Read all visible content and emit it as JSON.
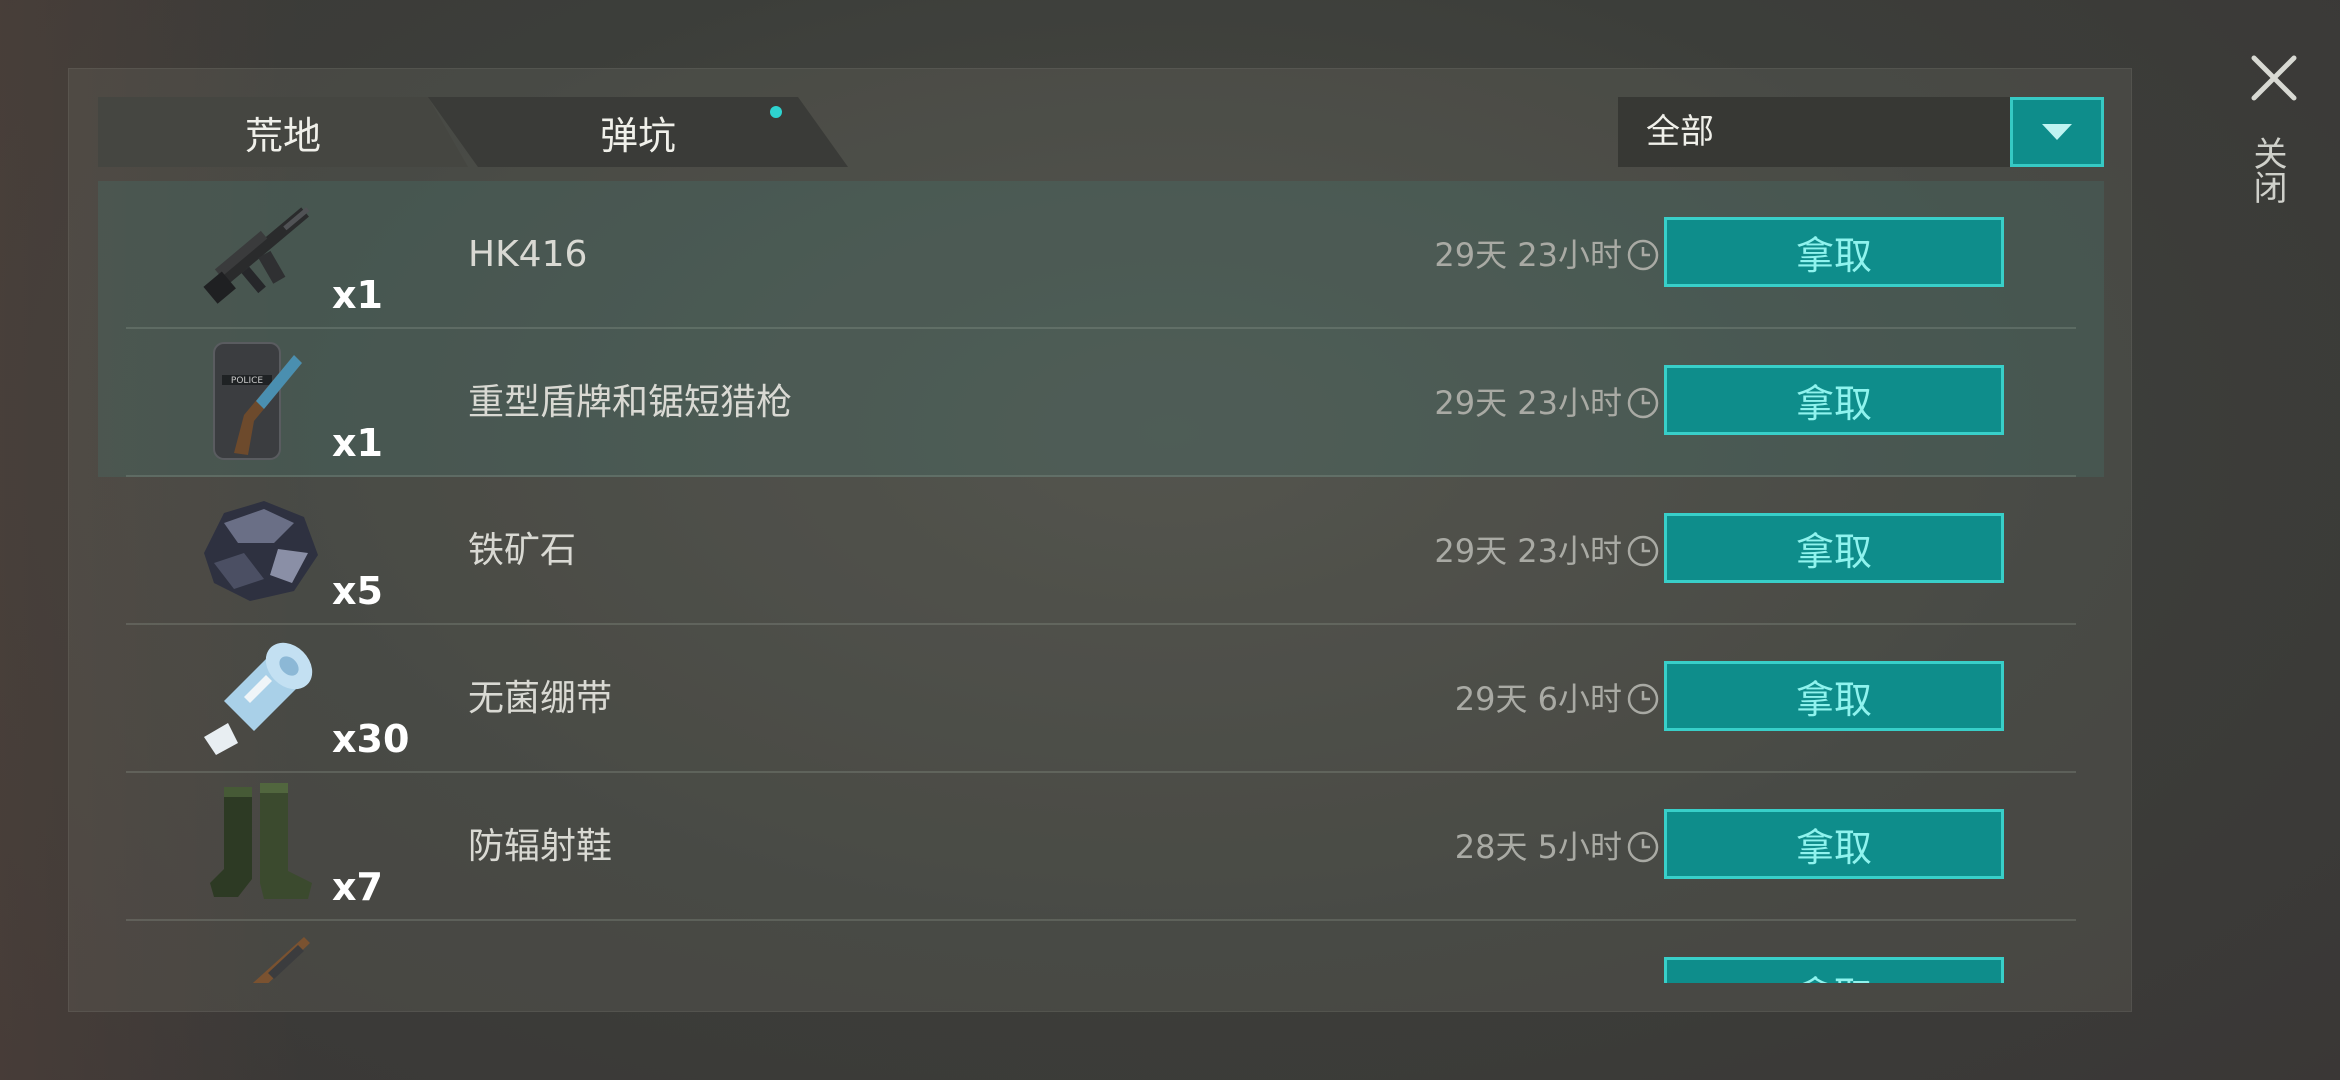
{
  "tabs": [
    {
      "label": "荒地",
      "active": true
    },
    {
      "label": "弹坑",
      "active": false,
      "has_notification": true
    }
  ],
  "filter": {
    "selected": "全部"
  },
  "items": [
    {
      "name": "HK416",
      "qty": "x1",
      "timer": "29天 23小时",
      "action": "拿取",
      "icon": "assault-rifle"
    },
    {
      "name": "重型盾牌和锯短猎枪",
      "qty": "x1",
      "timer": "29天 23小时",
      "action": "拿取",
      "icon": "riot-shield-shotgun"
    },
    {
      "name": "铁矿石",
      "qty": "x5",
      "timer": "29天 23小时",
      "action": "拿取",
      "icon": "iron-ore"
    },
    {
      "name": "无菌绷带",
      "qty": "x30",
      "timer": "29天 6小时",
      "action": "拿取",
      "icon": "bandage"
    },
    {
      "name": "防辐射鞋",
      "qty": "x7",
      "timer": "28天 5小时",
      "action": "拿取",
      "icon": "rubber-boots"
    },
    {
      "name": "",
      "qty": "",
      "timer": "",
      "action": "拿取",
      "icon": "rifle"
    }
  ],
  "close": {
    "label": "关闭"
  },
  "colors": {
    "accent": "#0e8d8b",
    "accent_border": "#38cfc9",
    "button_text": "#8ff3ee",
    "notification_dot": "#2ed3cf"
  }
}
